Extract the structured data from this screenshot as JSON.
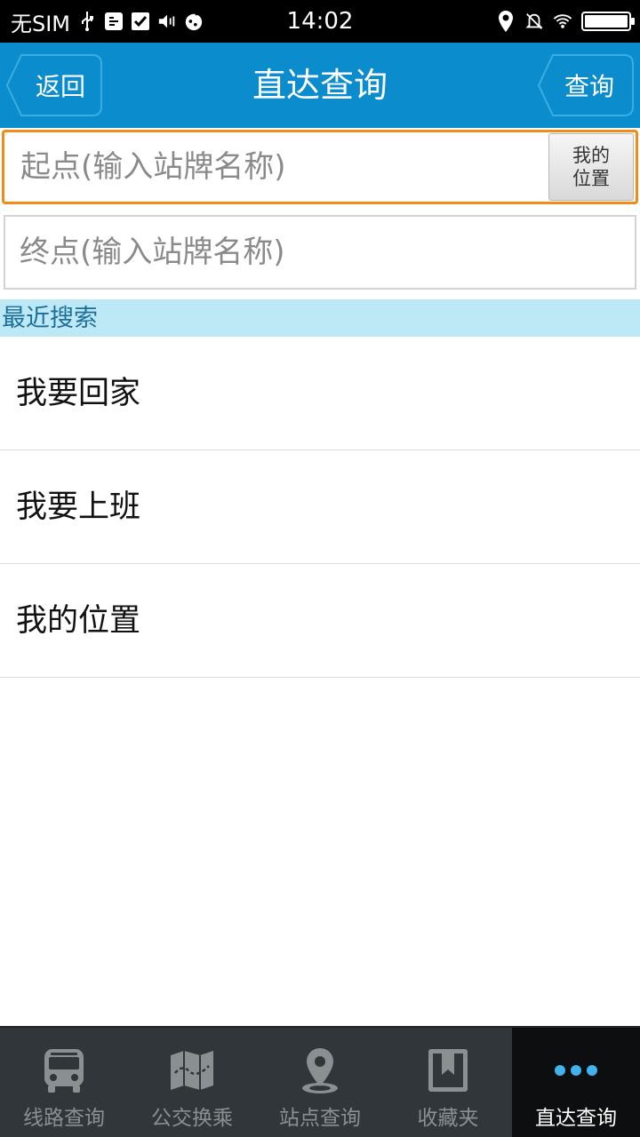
{
  "status_bar": {
    "carrier": "无SIM",
    "time": "14:02",
    "battery_level": 1.0,
    "icons": [
      "usb-icon",
      "usb-debug-icon",
      "checkbox-icon",
      "vibrate-icon",
      "app-icon",
      "location-icon",
      "mute-icon",
      "wifi-icon",
      "battery-icon"
    ]
  },
  "header": {
    "back_label": "返回",
    "title": "直达查询",
    "query_label": "查询",
    "color": "#0b8ccd"
  },
  "form": {
    "start_placeholder": "起点(输入站牌名称)",
    "start_value": "",
    "my_location_line1": "我的",
    "my_location_line2": "位置",
    "end_placeholder": "终点(输入站牌名称)",
    "end_value": "",
    "focus_color": "#f08c1c"
  },
  "recent": {
    "header": "最近搜索",
    "items": [
      {
        "label": "我要回家"
      },
      {
        "label": "我要上班"
      },
      {
        "label": "我的位置"
      }
    ]
  },
  "tabs": [
    {
      "label": "线路查询",
      "icon": "bus-icon",
      "active": false
    },
    {
      "label": "公交换乘",
      "icon": "map-icon",
      "active": false
    },
    {
      "label": "站点查询",
      "icon": "map-pin-icon",
      "active": false
    },
    {
      "label": "收藏夹",
      "icon": "bookmark-icon",
      "active": false
    },
    {
      "label": "直达查询",
      "icon": "more-dots-icon",
      "active": true
    }
  ]
}
